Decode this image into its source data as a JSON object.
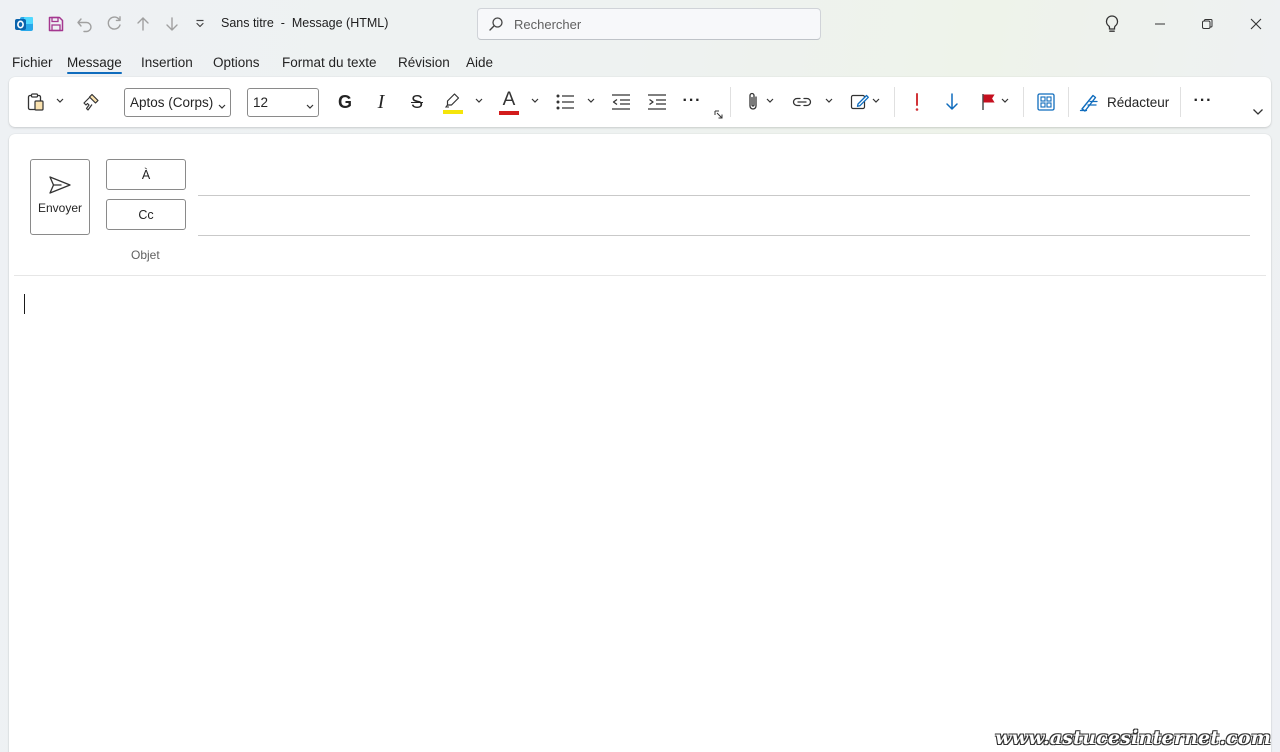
{
  "titlebar": {
    "title": "Sans titre  -  Message (HTML)",
    "search_placeholder": "Rechercher"
  },
  "menu": {
    "items": [
      "Fichier",
      "Message",
      "Insertion",
      "Options",
      "Format du texte",
      "Révision",
      "Aide"
    ],
    "active": "Message"
  },
  "ribbon": {
    "font_name": "Aptos (Corps)",
    "font_size": "12",
    "bold_label": "G",
    "italic_label": "I",
    "strike_label": "S",
    "font_color_label": "A",
    "more_label": "···",
    "editor_label": "Rédacteur",
    "colors": {
      "highlight": "#f5e50a",
      "font_color": "#d31c1c",
      "importance_high": "#d13438",
      "importance_low": "#0f6cbd",
      "flag": "#c50f1f",
      "accent": "#0f6cbd"
    }
  },
  "compose": {
    "send_label": "Envoyer",
    "to_label": "À",
    "cc_label": "Cc",
    "subject_label": "Objet",
    "to_value": "",
    "cc_value": "",
    "subject_value": ""
  },
  "watermark": "www.astucesinternet.com"
}
